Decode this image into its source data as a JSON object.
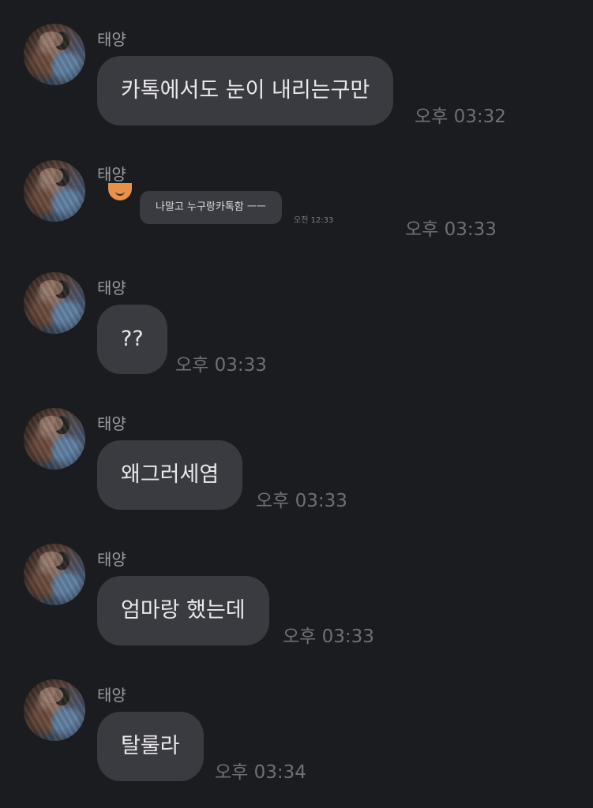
{
  "messages": [
    {
      "sender": "태양",
      "text": "카톡에서도 눈이 내리는구만",
      "time": "오후 03:32"
    },
    {
      "sender": "태양",
      "embedded": {
        "text": "나말고 누구랑카톡함 ㅡㅡ",
        "time": "오전 12:33"
      },
      "time": "오후 03:33"
    },
    {
      "sender": "태양",
      "text": "??",
      "time": "오후 03:33"
    },
    {
      "sender": "태양",
      "text": "왜그러세염",
      "time": "오후 03:33"
    },
    {
      "sender": "태양",
      "text": "엄마랑 했는데",
      "time": "오후 03:33"
    },
    {
      "sender": "태양",
      "text": "탈룰라",
      "time": "오후 03:34"
    }
  ],
  "colors": {
    "background": "#1b1c20",
    "bubble": "#3a3b40",
    "bubble_text": "#e9e9ec",
    "sender_name": "#9a9ba0",
    "timestamp": "#6f7075"
  }
}
